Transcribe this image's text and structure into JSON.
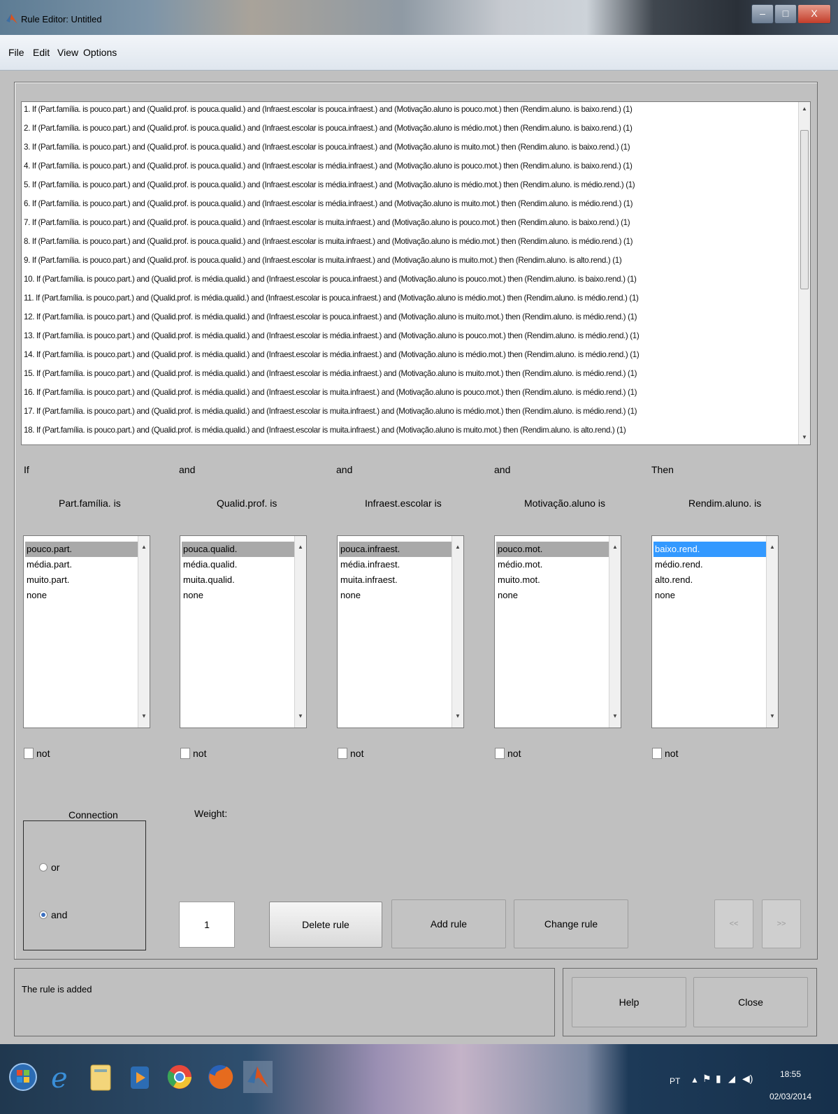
{
  "window": {
    "title": "Rule Editor: Untitled",
    "buttons": {
      "minimize": "–",
      "maximize": "□",
      "close": "X"
    }
  },
  "menu": [
    "File",
    "Edit",
    "View",
    "Options"
  ],
  "rules": [
    "1. If (Part.família. is pouco.part.) and (Qualid.prof. is pouca.qualid.) and (Infraest.escolar is pouca.infraest.) and (Motivação.aluno is pouco.mot.) then (Rendim.aluno. is baixo.rend.) (1)",
    "2. If (Part.família. is pouco.part.) and (Qualid.prof. is pouca.qualid.) and (Infraest.escolar is pouca.infraest.) and (Motivação.aluno is médio.mot.) then (Rendim.aluno. is baixo.rend.) (1)",
    "3. If (Part.família. is pouco.part.) and (Qualid.prof. is pouca.qualid.) and (Infraest.escolar is pouca.infraest.) and (Motivação.aluno is muito.mot.) then (Rendim.aluno. is baixo.rend.) (1)",
    "4. If (Part.família. is pouco.part.) and (Qualid.prof. is pouca.qualid.) and (Infraest.escolar is média.infraest.) and (Motivação.aluno is pouco.mot.) then (Rendim.aluno. is baixo.rend.) (1)",
    "5. If (Part.família. is pouco.part.) and (Qualid.prof. is pouca.qualid.) and (Infraest.escolar is média.infraest.) and (Motivação.aluno is médio.mot.) then (Rendim.aluno. is médio.rend.) (1)",
    "6. If (Part.família. is pouco.part.) and (Qualid.prof. is pouca.qualid.) and (Infraest.escolar is média.infraest.) and (Motivação.aluno is muito.mot.) then (Rendim.aluno. is médio.rend.) (1)",
    "7. If (Part.família. is pouco.part.) and (Qualid.prof. is pouca.qualid.) and (Infraest.escolar is muita.infraest.) and (Motivação.aluno is pouco.mot.) then (Rendim.aluno. is baixo.rend.) (1)",
    "8. If (Part.família. is pouco.part.) and (Qualid.prof. is pouca.qualid.) and (Infraest.escolar is muita.infraest.) and (Motivação.aluno is médio.mot.) then (Rendim.aluno. is médio.rend.) (1)",
    "9. If (Part.família. is pouco.part.) and (Qualid.prof. is pouca.qualid.) and (Infraest.escolar is muita.infraest.) and (Motivação.aluno is muito.mot.) then (Rendim.aluno. is alto.rend.) (1)",
    "10. If (Part.família. is pouco.part.) and (Qualid.prof. is média.qualid.) and (Infraest.escolar is pouca.infraest.) and (Motivação.aluno is pouco.mot.) then (Rendim.aluno. is baixo.rend.) (1)",
    "11. If (Part.família. is pouco.part.) and (Qualid.prof. is média.qualid.) and (Infraest.escolar is pouca.infraest.) and (Motivação.aluno is médio.mot.) then (Rendim.aluno. is médio.rend.) (1)",
    "12. If (Part.família. is pouco.part.) and (Qualid.prof. is média.qualid.) and (Infraest.escolar is pouca.infraest.) and (Motivação.aluno is muito.mot.) then (Rendim.aluno. is médio.rend.) (1)",
    "13. If (Part.família. is pouco.part.) and (Qualid.prof. is média.qualid.) and (Infraest.escolar is média.infraest.) and (Motivação.aluno is pouco.mot.) then (Rendim.aluno. is médio.rend.) (1)",
    "14. If (Part.família. is pouco.part.) and (Qualid.prof. is média.qualid.) and (Infraest.escolar is média.infraest.) and (Motivação.aluno is médio.mot.) then (Rendim.aluno. is médio.rend.) (1)",
    "15. If (Part.família. is pouco.part.) and (Qualid.prof. is média.qualid.) and (Infraest.escolar is média.infraest.) and (Motivação.aluno is muito.mot.) then (Rendim.aluno. is médio.rend.) (1)",
    "16. If (Part.família. is pouco.part.) and (Qualid.prof. is média.qualid.) and (Infraest.escolar is muita.infraest.) and (Motivação.aluno is pouco.mot.) then (Rendim.aluno. is médio.rend.) (1)",
    "17. If (Part.família. is pouco.part.) and (Qualid.prof. is média.qualid.) and (Infraest.escolar is muita.infraest.) and (Motivação.aluno is médio.mot.) then (Rendim.aluno. is médio.rend.) (1)",
    "18. If (Part.família. is pouco.part.) and (Qualid.prof. is média.qualid.) and (Infraest.escolar is muita.infraest.) and (Motivação.aluno is muito.mot.) then (Rendim.aluno. is alto.rend.) (1)"
  ],
  "columns": [
    {
      "connector": "If",
      "header": "Part.família. is",
      "options": [
        "pouco.part.",
        "média.part.",
        "muito.part.",
        "none"
      ],
      "not_label": "not"
    },
    {
      "connector": "and",
      "header": "Qualid.prof. is",
      "options": [
        "pouca.qualid.",
        "média.qualid.",
        "muita.qualid.",
        "none"
      ],
      "not_label": "not"
    },
    {
      "connector": "and",
      "header": "Infraest.escolar is",
      "options": [
        "pouca.infraest.",
        "média.infraest.",
        "muita.infraest.",
        "none"
      ],
      "not_label": "not"
    },
    {
      "connector": "and",
      "header": "Motivação.aluno is",
      "options": [
        "pouco.mot.",
        "médio.mot.",
        "muito.mot.",
        "none"
      ],
      "not_label": "not"
    },
    {
      "connector": "Then",
      "header": "Rendim.aluno. is",
      "options": [
        "baixo.rend.",
        "médio.rend.",
        "alto.rend.",
        "none"
      ],
      "not_label": "not"
    }
  ],
  "connection": {
    "title": "Connection",
    "or_label": "or",
    "and_label": "and",
    "selected": "and"
  },
  "weight": {
    "label": "Weight:",
    "value": "1"
  },
  "buttons": {
    "delete": "Delete rule",
    "add": "Add rule",
    "change": "Change rule",
    "prev": "<<",
    "next": ">>",
    "help": "Help",
    "close": "Close"
  },
  "status": "The rule is added",
  "taskbar": {
    "lang": "PT",
    "time": "18:55",
    "date": "02/03/2014"
  },
  "colors": {
    "selection_blue": "#3399ff",
    "selection_gray": "#a9a9a9",
    "background": "#c0c0c0"
  }
}
